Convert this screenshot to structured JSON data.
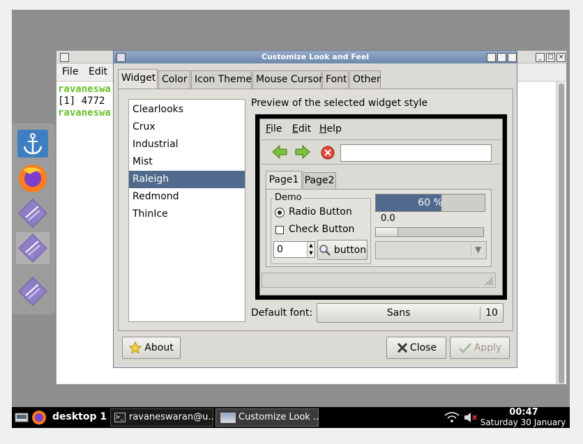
{
  "terminal": {
    "menu": [
      "File",
      "Edit"
    ],
    "lines": [
      "ravaneswa",
      "[1] 4772",
      "ravaneswa"
    ]
  },
  "dock": {
    "items": [
      "anchor-icon",
      "firefox-icon",
      "app-icon",
      "app-icon",
      "app-icon"
    ]
  },
  "dialog": {
    "title": "Customize Look and Feel",
    "tabs": [
      "Widget",
      "Color",
      "Icon Theme",
      "Mouse Cursor",
      "Font",
      "Other"
    ],
    "themes": [
      "Clearlooks",
      "Crux",
      "Industrial",
      "Mist",
      "Raleigh",
      "Redmond",
      "ThinIce"
    ],
    "selected_theme": "Raleigh",
    "preview_label": "Preview of the selected widget style",
    "preview": {
      "menu": [
        "File",
        "Edit",
        "Help"
      ],
      "tabs": [
        "Page1",
        "Page2"
      ],
      "group_label": "Demo",
      "radio_label": "Radio Button",
      "check_label": "Check Button",
      "spin_value": "0",
      "button_label": "button",
      "progress_text": "60 %",
      "progress_fraction": 0.6,
      "scale_value": "0.0"
    },
    "default_font_label": "Default font:",
    "font_name": "Sans",
    "font_size": "10",
    "about_label": "About",
    "close_label": "Close",
    "apply_label": "Apply"
  },
  "taskbar": {
    "desktop_label": "desktop 1",
    "tasks": [
      "ravaneswaran@u...",
      "Customize Look ..."
    ],
    "time": "00:47",
    "date": "Saturday 30 January"
  },
  "colors": {
    "selection": "#4f6a8c",
    "title_bar": "#7991b5",
    "terminal_prompt": "#6bbf2c",
    "taskbar": "#000000"
  }
}
